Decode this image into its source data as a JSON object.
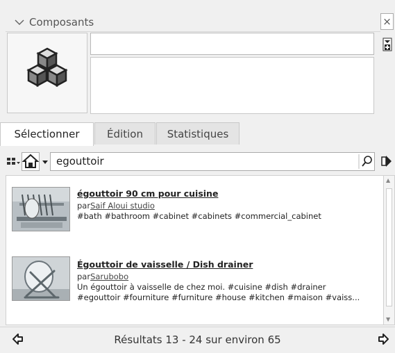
{
  "panel": {
    "title": "Composants",
    "close_label": "×"
  },
  "component": {
    "name_value": "",
    "description_value": ""
  },
  "tabs": [
    {
      "label": "Sélectionner",
      "active": true
    },
    {
      "label": "Édition",
      "active": false
    },
    {
      "label": "Statistiques",
      "active": false
    }
  ],
  "search": {
    "query": "egouttoir"
  },
  "results": [
    {
      "title": "égouttoir 90 cm pour cuisine",
      "by": "par",
      "author": "Saif Aloui studio",
      "description": "#bath #bathroom #cabinet #cabinets #commercial_cabinet"
    },
    {
      "title": "Égouttoir de vaisselle / Dish drainer",
      "by": "par",
      "author": "Sarubobo",
      "description_line1": "Un égouttoir à vaisselle de chez moi. #cuisine #dish #drainer",
      "description_line2": "#egouttoir #fourniture #furniture #house #kitchen #maison #vaiss..."
    }
  ],
  "footer": {
    "results_text": "Résultats 13 - 24 sur environ 65"
  },
  "icons": {
    "title_chevron": "chevron-down-icon",
    "component_preview": "components-cubes-icon",
    "details": "details-arrow-icon",
    "view_options": "view-options-icon",
    "home": "home-icon",
    "dropdown": "dropdown-arrow-icon",
    "search": "search-icon",
    "go": "go-arrow-icon",
    "prev": "previous-page-icon",
    "next": "next-page-icon"
  }
}
